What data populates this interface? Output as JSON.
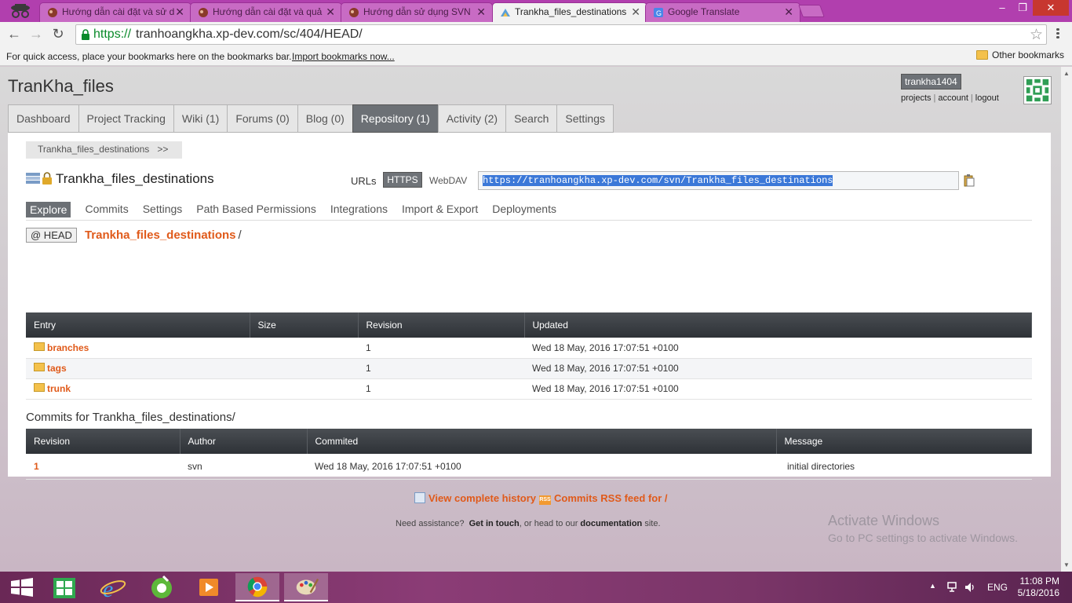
{
  "browser": {
    "tabs": [
      {
        "title": "Hướng dẫn cài đặt và sử d",
        "active": false
      },
      {
        "title": "Hướng dẫn cài đặt và quả",
        "active": false
      },
      {
        "title": "Hướng dẫn sử dụng SVN",
        "active": false
      },
      {
        "title": "Trankha_files_destinations",
        "active": true
      },
      {
        "title": "Google Translate",
        "active": false
      }
    ],
    "url_scheme": "https://",
    "url_rest": "tranhoangkha.xp-dev.com/sc/404/HEAD/",
    "bookmarks_hint": "For quick access, place your bookmarks here on the bookmarks bar.",
    "import_bookmarks": "Import bookmarks now...",
    "other_bookmarks": "Other bookmarks",
    "window_controls": {
      "min": "–",
      "max": "❐",
      "close": "✕"
    }
  },
  "site": {
    "project_title": "TranKha_files",
    "username": "trankha1404",
    "user_links": [
      "projects",
      "account",
      "logout"
    ],
    "nav_tabs": [
      "Dashboard",
      "Project Tracking",
      "Wiki (1)",
      "Forums (0)",
      "Blog (0)",
      "Repository (1)",
      "Activity (2)",
      "Search",
      "Settings"
    ],
    "active_tab_index": 5
  },
  "repo": {
    "breadcrumb": "Trankha_files_destinations",
    "breadcrumb_arrow": ">>",
    "name": "Trankha_files_destinations",
    "urls_label": "URLs",
    "https_label": "HTTPS",
    "webdav_label": "WebDAV",
    "checkout_url": "https://tranhoangkha.xp-dev.com/svn/Trankha_files_destinations",
    "subnav": [
      "Explore",
      "Commits",
      "Settings",
      "Path Based Permissions",
      "Integrations",
      "Import & Export",
      "Deployments"
    ],
    "head_label": "@ HEAD",
    "path_link": "Trankha_files_destinations",
    "path_sep": "/"
  },
  "entries": {
    "headers": [
      "Entry",
      "Size",
      "Revision",
      "Updated"
    ],
    "rows": [
      {
        "name": "branches",
        "size": "",
        "revision": "1",
        "updated": "Wed 18 May, 2016 17:07:51 +0100"
      },
      {
        "name": "tags",
        "size": "",
        "revision": "1",
        "updated": "Wed 18 May, 2016 17:07:51 +0100"
      },
      {
        "name": "trunk",
        "size": "",
        "revision": "1",
        "updated": "Wed 18 May, 2016 17:07:51 +0100"
      }
    ]
  },
  "commits": {
    "title": "Commits for Trankha_files_destinations/",
    "headers": [
      "Revision",
      "Author",
      "Commited",
      "Message"
    ],
    "rows": [
      {
        "revision": "1",
        "author": "svn",
        "committed": "Wed 18 May, 2016 17:07:51 +0100",
        "message": "initial directories"
      }
    ]
  },
  "footer": {
    "history_link": "View complete history",
    "rss_link": "Commits RSS feed for /",
    "assist_prefix": "Need assistance?",
    "get_in_touch": "Get in touch",
    "assist_mid": ", or head to our",
    "documentation": "documentation",
    "assist_suffix": "site."
  },
  "watermark": {
    "line1": "Activate Windows",
    "line2": "Go to PC settings to activate Windows."
  },
  "taskbar": {
    "language": "ENG",
    "time": "11:08 PM",
    "date": "5/18/2016"
  }
}
